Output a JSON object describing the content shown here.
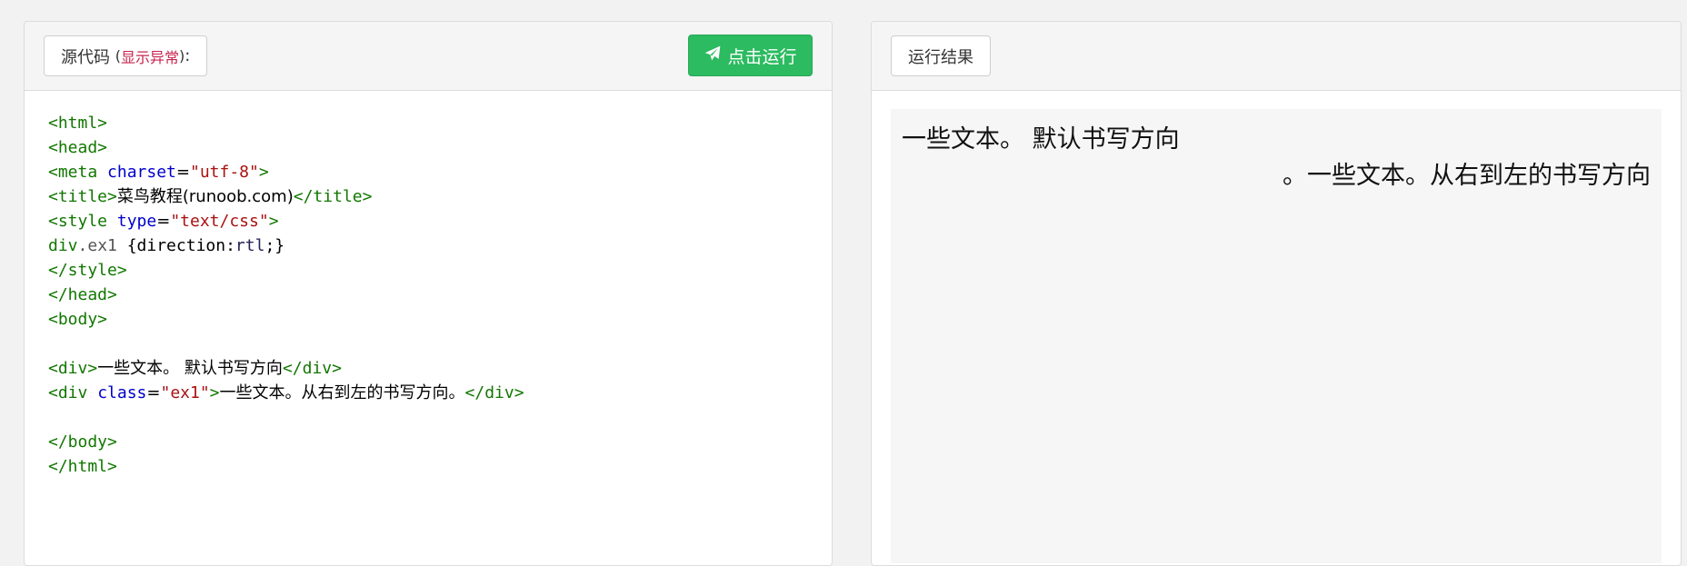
{
  "source_panel": {
    "label_main": "源代码",
    "label_paren_open": "(",
    "label_anomaly": "显示异常",
    "label_paren_close": ")",
    "label_colon": ":",
    "run_button_label": "点击运行",
    "run_icon": "paper-plane-icon",
    "code_lines": {
      "l1": "<html>",
      "l2": "<head>",
      "l3_open": "<meta",
      "l3_attr": "charset",
      "l3_eq": "=",
      "l3_val": "\"utf-8\"",
      "l3_close": ">",
      "l4_open": "<title>",
      "l4_text": "菜鸟教程(runoob.com)",
      "l4_close": "</title>",
      "l5_open": "<style",
      "l5_attr": "type",
      "l5_eq": "=",
      "l5_val": "\"text/css\"",
      "l5_close": ">",
      "l6_sel_tag": "div",
      "l6_sel_class": ".ex1",
      "l6_rule_a": " {direction:",
      "l6_rule_val": "rtl",
      "l6_rule_b": ";}",
      "l7": "</style>",
      "l8": "</head>",
      "l9": "<body>",
      "l11_open": "<div>",
      "l11_text": "一些文本。 默认书写方向",
      "l11_close": "</div>",
      "l12_open": "<div",
      "l12_attr": " class",
      "l12_eq": "=",
      "l12_val": "\"ex1\"",
      "l12_gt": ">",
      "l12_text": "一些文本。从右到左的书写方向。",
      "l12_close": "</div>",
      "l14": "</body>",
      "l15": "</html>"
    }
  },
  "result_panel": {
    "label": "运行结果",
    "line1": "一些文本。 默认书写方向",
    "line2": "一些文本。从右到左的书写方向。"
  }
}
